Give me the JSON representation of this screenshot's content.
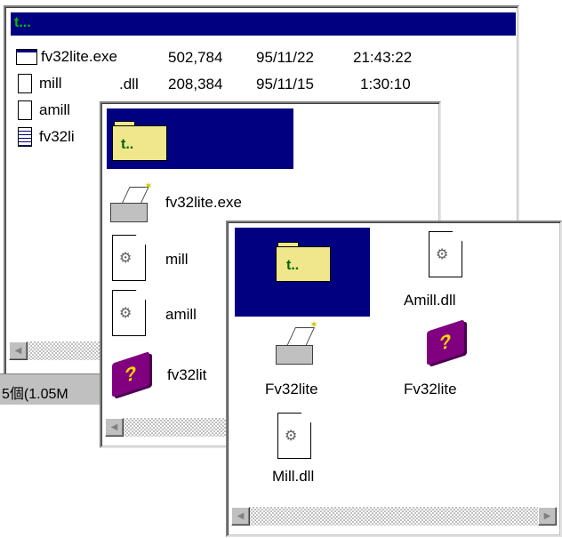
{
  "details_view": {
    "parent_row": "t...",
    "rows": [
      {
        "name": "fv32lite",
        "ext": ".exe",
        "size": "502,784",
        "date": "95/11/22",
        "time": "21:43:22",
        "icon": "exe-window-icon"
      },
      {
        "name": "mill",
        "ext": ".dll",
        "size": "208,384",
        "date": "95/11/15",
        "time": "1:30:10",
        "icon": "document-icon"
      },
      {
        "name": "amill",
        "ext": "",
        "size": "",
        "date": "",
        "time": "",
        "icon": "document-icon"
      },
      {
        "name": "fv32li",
        "ext": "",
        "size": "",
        "date": "",
        "time": "",
        "icon": "notepad-icon"
      }
    ],
    "status": "5個(1.05M"
  },
  "list_view": {
    "parent_label": "t..",
    "items": [
      {
        "label": "fv32lite.exe",
        "icon": "printer-icon"
      },
      {
        "label": "mill",
        "icon": "gear-document-icon"
      },
      {
        "label": "amill",
        "icon": "gear-document-icon"
      },
      {
        "label": "fv32lit",
        "icon": "help-book-icon"
      }
    ]
  },
  "icon_view": {
    "parent_label": "t..",
    "items": [
      {
        "label": "Amill.dll",
        "icon": "gear-document-icon"
      },
      {
        "label": "Fv32lite",
        "icon": "printer-icon"
      },
      {
        "label": "Fv32lite",
        "icon": "help-book-icon"
      },
      {
        "label": "Mill.dll",
        "icon": "gear-document-icon"
      }
    ]
  },
  "colors": {
    "selection": "#000080",
    "folder": "#f0e68c",
    "book": "#800080"
  }
}
